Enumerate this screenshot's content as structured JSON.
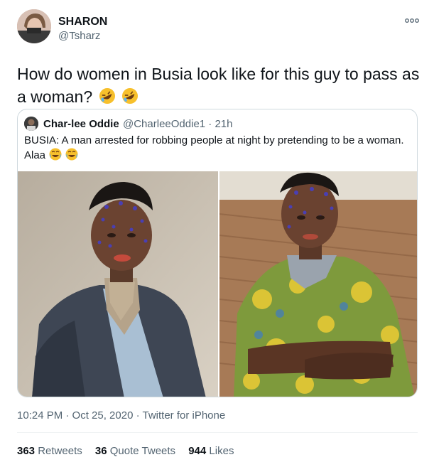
{
  "tweet": {
    "author_name": "SHARON",
    "author_handle": "@Tsharz",
    "text": "How do women in Busia look like for this guy to pass as a woman?",
    "text_emoji": [
      "rolling-on-floor-laughing-icon",
      "rolling-on-floor-laughing-icon"
    ]
  },
  "quote": {
    "author_name": "Char-lee Oddie",
    "author_handle": "@CharleeOddie1 · 21h",
    "text": "BUSIA: A man arrested for robbing people at night by pretending to be a woman. Alaa",
    "text_emoji": [
      "joy-icon",
      "joy-icon"
    ],
    "photos": [
      "man-in-grey-suit-photo",
      "man-in-green-print-dress-photo"
    ]
  },
  "meta": {
    "timestamp": "10:24 PM · Oct 25, 2020 · Twitter for iPhone"
  },
  "stats": {
    "retweets_count": "363",
    "retweets_label": "Retweets",
    "quotes_count": "36",
    "quotes_label": "Quote Tweets",
    "likes_count": "944",
    "likes_label": "Likes"
  },
  "colors": {
    "text_primary": "#0f1419",
    "text_secondary": "#536471",
    "border": "#cfd9de"
  }
}
